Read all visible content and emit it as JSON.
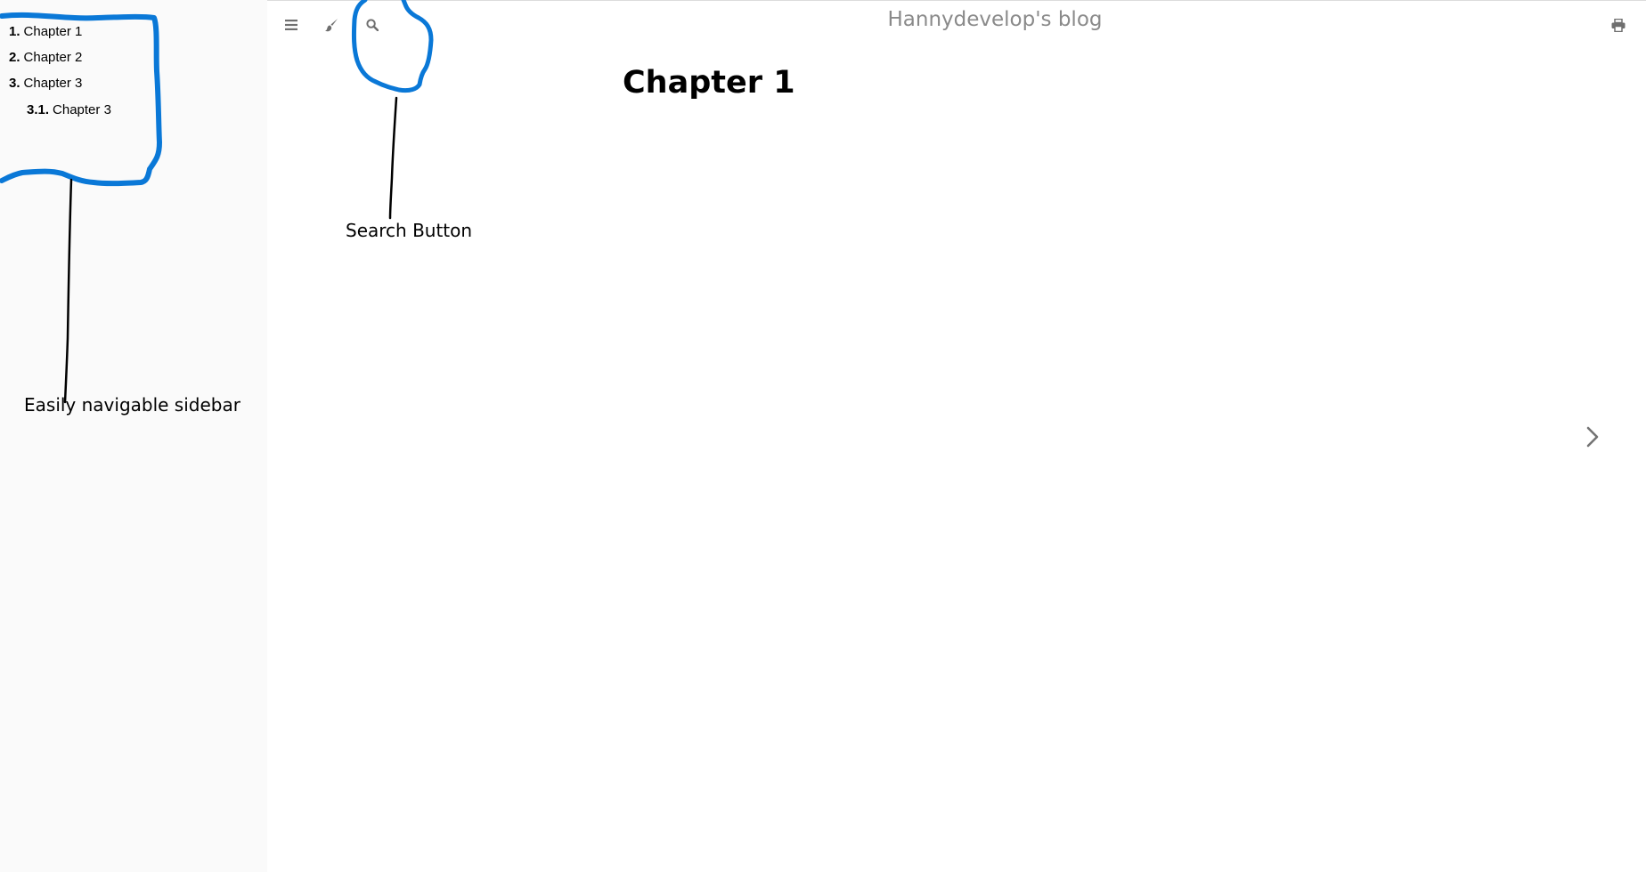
{
  "sidebar": {
    "items": [
      {
        "number": "1.",
        "label": "Chapter 1"
      },
      {
        "number": "2.",
        "label": "Chapter 2"
      },
      {
        "number": "3.",
        "label": "Chapter 3"
      },
      {
        "number": "3.1.",
        "label": "Chapter 3"
      }
    ]
  },
  "toolbar": {
    "icons": [
      "menu-icon",
      "paintbrush-icon",
      "search-icon",
      "print-icon"
    ]
  },
  "header": {
    "title": "Hannydevelop's blog"
  },
  "content": {
    "chapter_title": "Chapter 1"
  },
  "navigation": {
    "next_icon": "chevron-right-icon"
  },
  "annotations": {
    "sidebar_label": "Easily navigable sidebar",
    "search_label": "Search Button",
    "highlight_color": "#0a78d7"
  }
}
